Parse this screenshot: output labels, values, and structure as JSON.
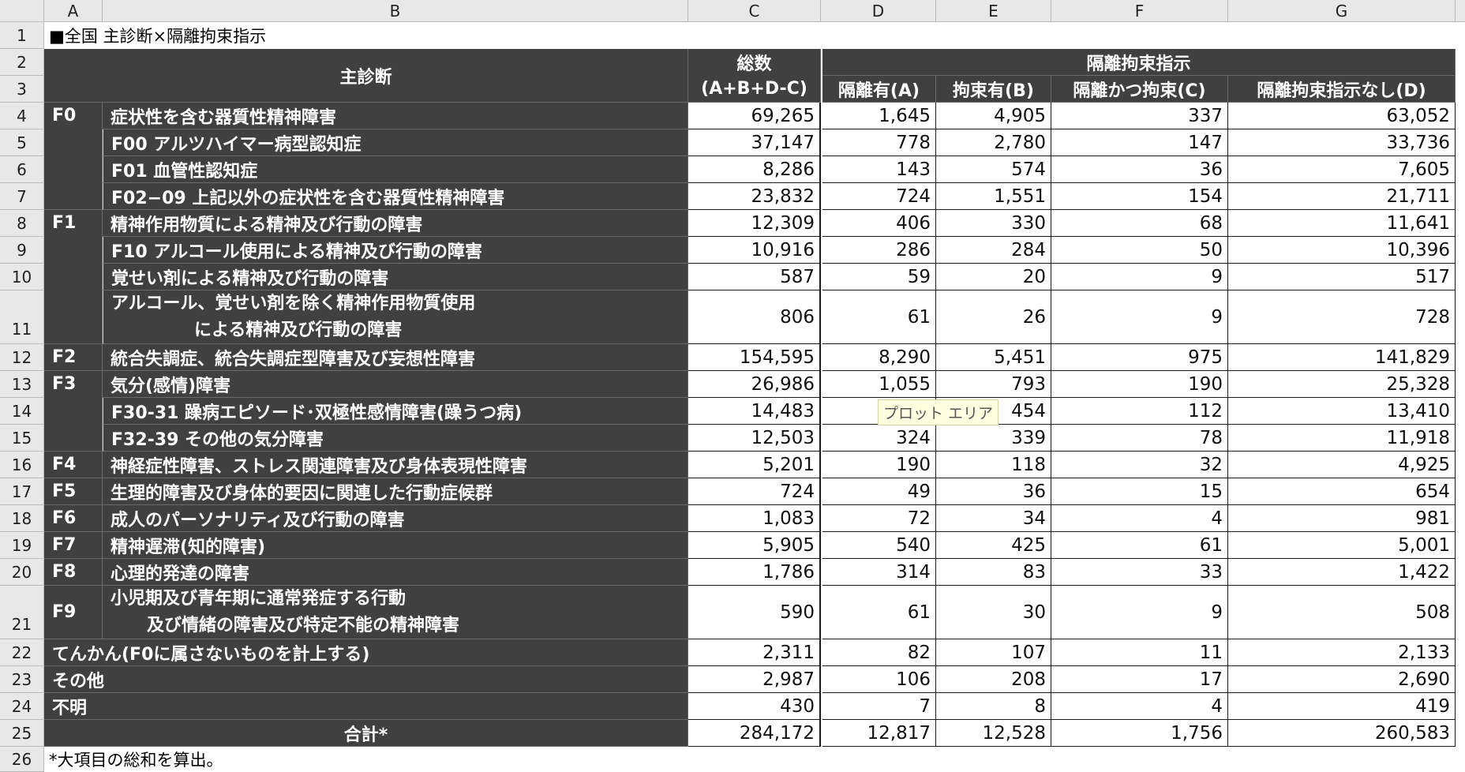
{
  "columns": [
    "A",
    "B",
    "C",
    "D",
    "E",
    "F",
    "G"
  ],
  "rows": [
    "1",
    "2",
    "3",
    "4",
    "5",
    "6",
    "7",
    "8",
    "9",
    "10",
    "11",
    "12",
    "13",
    "14",
    "15",
    "16",
    "17",
    "18",
    "19",
    "20",
    "21",
    "22",
    "23",
    "24",
    "25",
    "26"
  ],
  "title": "■全国 主診断×隔離拘束指示",
  "header": {
    "main_diag": "主診断",
    "total_line1": "総数",
    "total_line2": "(A+B+D-C)",
    "group": "隔離拘束指示",
    "d": "隔離有(A)",
    "e": "拘束有(B)",
    "f": "隔離かつ拘束(C)",
    "g": "隔離拘束指示なし(D)"
  },
  "codes": {
    "r4": "F0",
    "r8": "F1",
    "r12": "F2",
    "r13": "F3",
    "r16": "F4",
    "r17": "F5",
    "r18": "F6",
    "r19": "F7",
    "r20": "F8",
    "r21": "F9"
  },
  "labels": {
    "r4": "症状性を含む器質性精神障害",
    "r5": "F00 アルツハイマー病型認知症",
    "r6": "F01 血管性認知症",
    "r7": "F02−09 上記以外の症状性を含む器質性精神障害",
    "r8": "精神作用物質による精神及び行動の障害",
    "r9": "F10 アルコール使用による精神及び行動の障害",
    "r10": "覚せい剤による精神及び行動の障害",
    "r11a": "アルコール、覚せい剤を除く精神作用物質使用",
    "r11b": "による精神及び行動の障害",
    "r12": "統合失調症、統合失調症型障害及び妄想性障害",
    "r13": "気分(感情)障害",
    "r14": "F30-31  躁病エピソード･双極性感情障害(躁うつ病)",
    "r15": "F32-39 その他の気分障害",
    "r16": "神経症性障害、ストレス関連障害及び身体表現性障害",
    "r17": "生理的障害及び身体的要因に関連した行動症候群",
    "r18": "成人のパーソナリティ及び行動の障害",
    "r19": "精神遅滞(知的障害)",
    "r20": "心理的発達の障害",
    "r21a": "小児期及び青年期に通常発症する行動",
    "r21b": "及び情緒の障害及び特定不能の精神障害",
    "r22": "てんかん(F0に属さないものを計上する)",
    "r23": "その他",
    "r24": "不明",
    "r25": "合計*"
  },
  "values": {
    "r4": [
      "69,265",
      "1,645",
      "4,905",
      "337",
      "63,052"
    ],
    "r5": [
      "37,147",
      "778",
      "2,780",
      "147",
      "33,736"
    ],
    "r6": [
      "8,286",
      "143",
      "574",
      "36",
      "7,605"
    ],
    "r7": [
      "23,832",
      "724",
      "1,551",
      "154",
      "21,711"
    ],
    "r8": [
      "12,309",
      "406",
      "330",
      "68",
      "11,641"
    ],
    "r9": [
      "10,916",
      "286",
      "284",
      "50",
      "10,396"
    ],
    "r10": [
      "587",
      "59",
      "20",
      "9",
      "517"
    ],
    "r11": [
      "806",
      "61",
      "26",
      "9",
      "728"
    ],
    "r12": [
      "154,595",
      "8,290",
      "5,451",
      "975",
      "141,829"
    ],
    "r13": [
      "26,986",
      "1,055",
      "793",
      "190",
      "25,328"
    ],
    "r14": [
      "14,483",
      "",
      "454",
      "112",
      "13,410"
    ],
    "r15": [
      "12,503",
      "324",
      "339",
      "78",
      "11,918"
    ],
    "r16": [
      "5,201",
      "190",
      "118",
      "32",
      "4,925"
    ],
    "r17": [
      "724",
      "49",
      "36",
      "15",
      "654"
    ],
    "r18": [
      "1,083",
      "72",
      "34",
      "4",
      "981"
    ],
    "r19": [
      "5,905",
      "540",
      "425",
      "61",
      "5,001"
    ],
    "r20": [
      "1,786",
      "314",
      "83",
      "33",
      "1,422"
    ],
    "r21": [
      "590",
      "61",
      "30",
      "9",
      "508"
    ],
    "r22": [
      "2,311",
      "82",
      "107",
      "11",
      "2,133"
    ],
    "r23": [
      "2,987",
      "106",
      "208",
      "17",
      "2,690"
    ],
    "r24": [
      "430",
      "7",
      "8",
      "4",
      "419"
    ],
    "r25": [
      "284,172",
      "12,817",
      "12,528",
      "1,756",
      "260,583"
    ]
  },
  "footnote": "*大項目の総和を算出。",
  "tooltip": "プロット エリア"
}
